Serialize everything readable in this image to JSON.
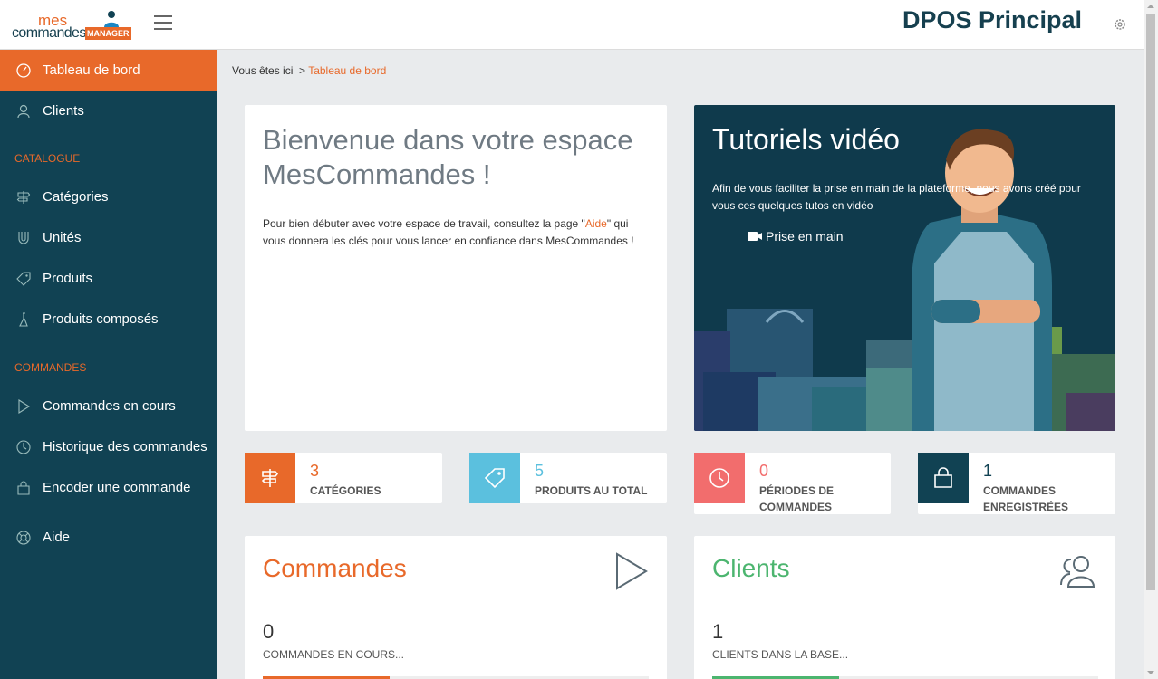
{
  "header": {
    "logo_line1": "mes",
    "logo_line2": "commandes",
    "logo_badge": "MANAGER",
    "app_title": "DPOS Principal"
  },
  "sidebar": {
    "items_top": [
      {
        "label": "Tableau de bord",
        "icon": "dashboard-icon",
        "active": true
      },
      {
        "label": "Clients",
        "icon": "users-icon"
      }
    ],
    "section_catalogue": "CATALOGUE",
    "items_catalogue": [
      {
        "label": "Catégories",
        "icon": "signpost-icon"
      },
      {
        "label": "Unités",
        "icon": "magnet-icon"
      },
      {
        "label": "Produits",
        "icon": "tag-icon"
      },
      {
        "label": "Produits composés",
        "icon": "flask-icon"
      }
    ],
    "section_commandes": "COMMANDES",
    "items_commandes": [
      {
        "label": "Commandes en cours",
        "icon": "play-icon"
      },
      {
        "label": "Historique des commandes",
        "icon": "clock-icon"
      },
      {
        "label": "Encoder une commande",
        "icon": "bag-icon"
      }
    ],
    "item_aide": {
      "label": "Aide",
      "icon": "lifebuoy-icon"
    }
  },
  "breadcrumb": {
    "prefix": "Vous êtes ici",
    "separator": ">",
    "current": "Tableau de bord"
  },
  "welcome": {
    "title": "Bienvenue dans votre espace MesCommandes !",
    "text_before": "Pour bien débuter avec votre espace de travail, consultez la page \"",
    "link": "Aide",
    "text_after": "\" qui vous donnera les clés pour vous lancer en confiance dans MesCommandes !"
  },
  "video": {
    "title": "Tutoriels vidéo",
    "text": "Afin de vous faciliter la prise en main de la plateforme, nous avons créé pour vous ces quelques tutos en vidéo",
    "link": "Prise en main"
  },
  "stats": [
    {
      "value": "3",
      "label": "CATÉGORIES",
      "color": "#e8692a",
      "icon": "signpost-icon"
    },
    {
      "value": "5",
      "label": "PRODUITS AU TOTAL",
      "color": "#5bc0de",
      "icon": "tag-icon"
    },
    {
      "value": "0",
      "label": "PÉRIODES DE COMMANDES",
      "color": "#f26d6d",
      "icon": "clock-icon"
    },
    {
      "value": "1",
      "label": "COMMANDES ENREGISTRÉES",
      "color": "#114253",
      "icon": "bag-icon"
    }
  ],
  "commandes_card": {
    "title": "Commandes",
    "count": "0",
    "sub": "COMMANDES EN COURS...",
    "color": "#e8692a"
  },
  "clients_card": {
    "title": "Clients",
    "count": "1",
    "sub": "CLIENTS DANS LA BASE...",
    "color": "#4cb56f"
  }
}
